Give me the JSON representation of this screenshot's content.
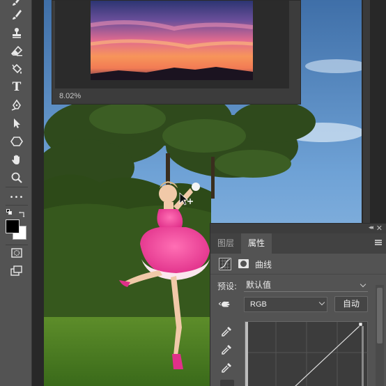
{
  "toolbar": {
    "tools": [
      {
        "name": "brush-tool-top",
        "icon": "brush-icon"
      },
      {
        "name": "brush-tool",
        "icon": "brush-icon"
      },
      {
        "name": "clone-stamp-tool",
        "icon": "stamp-icon"
      },
      {
        "name": "eraser-tool",
        "icon": "eraser-icon"
      },
      {
        "name": "paint-bucket-tool",
        "icon": "paint-bucket-icon"
      },
      {
        "name": "type-tool",
        "icon": "type-icon",
        "glyph": "T"
      },
      {
        "name": "pen-tool",
        "icon": "pen-icon"
      },
      {
        "name": "path-selection-tool",
        "icon": "arrow-icon"
      },
      {
        "name": "shape-tool",
        "icon": "hexagon-icon"
      },
      {
        "name": "hand-tool",
        "icon": "hand-icon"
      },
      {
        "name": "zoom-tool",
        "icon": "magnifier-icon"
      },
      {
        "name": "more-tools",
        "icon": "ellipsis-icon",
        "glyph": "•••"
      }
    ],
    "foreground_color": "#000000",
    "background_color": "#ffffff"
  },
  "preview": {
    "zoom": "8.02%"
  },
  "panel": {
    "tabs": [
      {
        "label": "图层",
        "active": false
      },
      {
        "label": "属性",
        "active": true
      }
    ],
    "adjustment_label": "曲线",
    "preset_label": "预设:",
    "preset_value": "默认值",
    "channel_value": "RGB",
    "auto_label": "自动"
  },
  "colors": {
    "ui_dark": "#282828",
    "panel": "#535353",
    "toolbar": "#535353"
  }
}
